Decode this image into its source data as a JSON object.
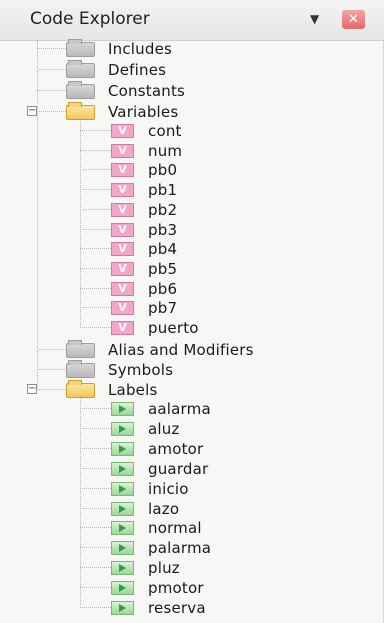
{
  "window": {
    "title": "Code Explorer",
    "dropdown_icon": "chevron-down-icon",
    "close_icon": "close-icon"
  },
  "tree": {
    "includes": "Includes",
    "defines": "Defines",
    "constants": "Constants",
    "variables": {
      "label": "Variables",
      "expander": "−",
      "items": [
        "cont",
        "num",
        "pb0",
        "pb1",
        "pb2",
        "pb3",
        "pb4",
        "pb5",
        "pb6",
        "pb7",
        "puerto"
      ]
    },
    "alias_modifiers": "Alias and Modifiers",
    "symbols": "Symbols",
    "labels": {
      "label": "Labels",
      "expander": "−",
      "items": [
        "aalarma",
        "aluz",
        "amotor",
        "guardar",
        "inicio",
        "lazo",
        "normal",
        "palarma",
        "pluz",
        "pmotor",
        "reserva"
      ]
    }
  },
  "icons": {
    "folder": "folder-icon",
    "variable": "variable-icon",
    "label": "label-icon"
  },
  "colors": {
    "variable_icon": "#f4a6c9",
    "label_icon": "#9cd69a",
    "close_button": "#e06a6a"
  }
}
